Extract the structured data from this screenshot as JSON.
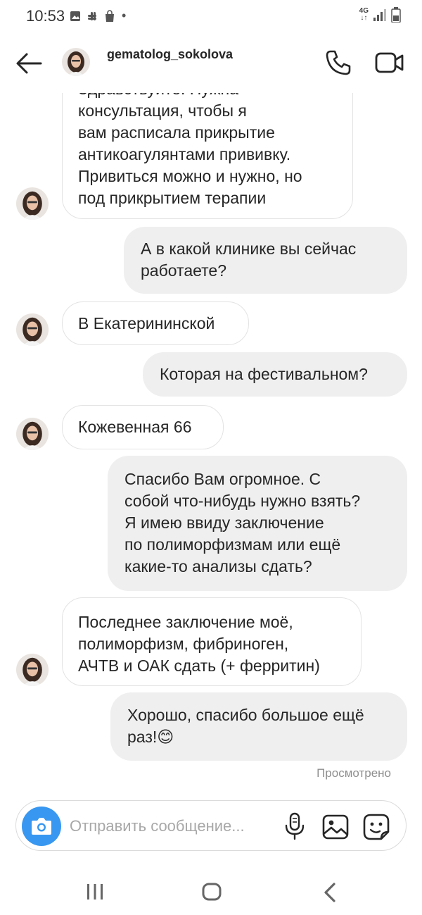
{
  "status_bar": {
    "time": "10:53",
    "network_top": "4G",
    "network_bottom": "↓↑",
    "dot": "•",
    "left_icons": [
      "gallery-icon",
      "slack-icon",
      "shopping-bag-icon"
    ],
    "right_icons": [
      "signal-icon",
      "battery-icon"
    ]
  },
  "header": {
    "username": "gematolog_sokolova",
    "icons": [
      "back-arrow-icon",
      "phone-icon",
      "video-camera-icon"
    ]
  },
  "messages": [
    {
      "from": "them",
      "lines": [
        "Здравствуйте. Нужна",
        "консультация, чтобы я",
        "вам расписала прикрытие",
        "антикоагулянтами прививку.",
        "Привиться можно и нужно, но",
        "под прикрытием терапии"
      ]
    },
    {
      "from": "me",
      "lines": [
        "А в какой клинике вы сейчас",
        "работаете?"
      ]
    },
    {
      "from": "them",
      "lines": [
        "В Екатерининской"
      ]
    },
    {
      "from": "me",
      "lines": [
        "Которая на фестивальном?"
      ]
    },
    {
      "from": "them",
      "lines": [
        "Кожевенная 66"
      ]
    },
    {
      "from": "me",
      "lines": [
        "Спасибо Вам огромное. С",
        "собой что-нибудь нужно взять?",
        "Я имею ввиду заключение",
        "по полиморфизмам или ещё",
        "какие-то анализы сдать?"
      ]
    },
    {
      "from": "them",
      "lines": [
        "Последнее заключение моё,",
        "полиморфизм, фибриноген,",
        "АЧТВ и ОАК сдать (+ ферритин)"
      ]
    },
    {
      "from": "me",
      "lines": [
        "Хорошо, спасибо большое ещё",
        "раз!😊"
      ]
    }
  ],
  "seen_label": "Просмотрено",
  "composer": {
    "placeholder": "Отправить сообщение...",
    "icons": [
      "camera-icon",
      "microphone-icon",
      "gallery-icon",
      "sticker-icon"
    ],
    "accent_color": "#3897f0"
  },
  "nav_bar": {
    "icons": [
      "recent-apps-icon",
      "home-icon",
      "back-icon"
    ]
  }
}
